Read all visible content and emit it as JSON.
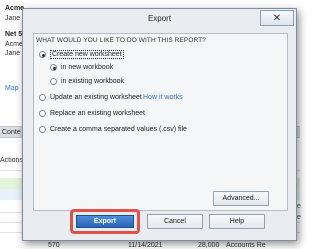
{
  "background": {
    "top_labels": [
      "Acme",
      "Jane",
      "Net 5",
      "Acme",
      "Jane"
    ],
    "map_link": "Map",
    "band_label": "Conte",
    "actions_label": "Actions",
    "right_labels": [
      "Re",
      "Re",
      "Che",
      "Che",
      "Re",
      "Re"
    ],
    "bottom_row": {
      "num": "570",
      "date": "11/14/2021",
      "amount": "28,000",
      "account": "Accounts Re"
    },
    "colors": {
      "green_row": "#e4f3dc",
      "blue_row": "#e7f1fb",
      "band": "#d9dde2"
    }
  },
  "dialog": {
    "title": "Export",
    "close_glyph": "✕",
    "prompt": "WHAT WOULD YOU LIKE TO DO WITH THIS REPORT?",
    "options": {
      "create_new": "Create new worksheet",
      "in_new_workbook": "in new workbook",
      "in_existing_workbook": "in existing workbook",
      "update_existing": "Update an existing worksheet",
      "how_it_works": "How it works",
      "replace_existing": "Replace an existing worksheet",
      "create_csv": "Create a comma separated values (.csv) file"
    },
    "buttons": {
      "advanced": "Advanced...",
      "export": "Export",
      "cancel": "Cancel",
      "help": "Help"
    },
    "colors": {
      "export_button": "#2a64b8",
      "highlight_ring": "#e2504a",
      "link": "#2f6bd1"
    }
  }
}
